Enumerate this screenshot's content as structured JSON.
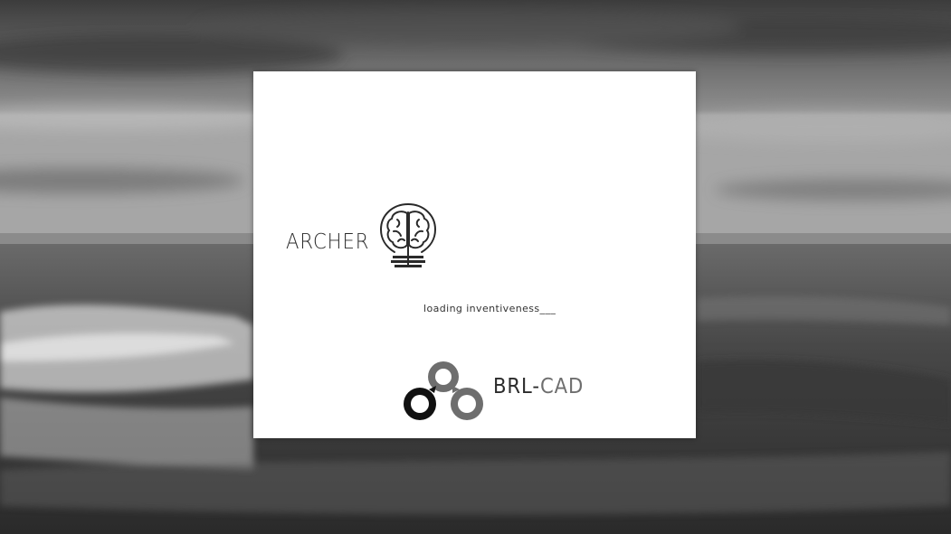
{
  "desktop": {
    "wallpaper_icon": "ocean-waves-wallpaper"
  },
  "splash": {
    "archer_label": "ARCHER",
    "archer_icon": "brain-lightbulb-icon",
    "loading_text": "loading inventiveness___",
    "brlcad_icon": "brlcad-rings-icon",
    "brl_text": "BRL-",
    "cad_text": "CAD"
  },
  "colors": {
    "splash_bg": "#ffffff",
    "text_dark": "#2b2b2b",
    "text_gray": "#6e6e6e"
  }
}
